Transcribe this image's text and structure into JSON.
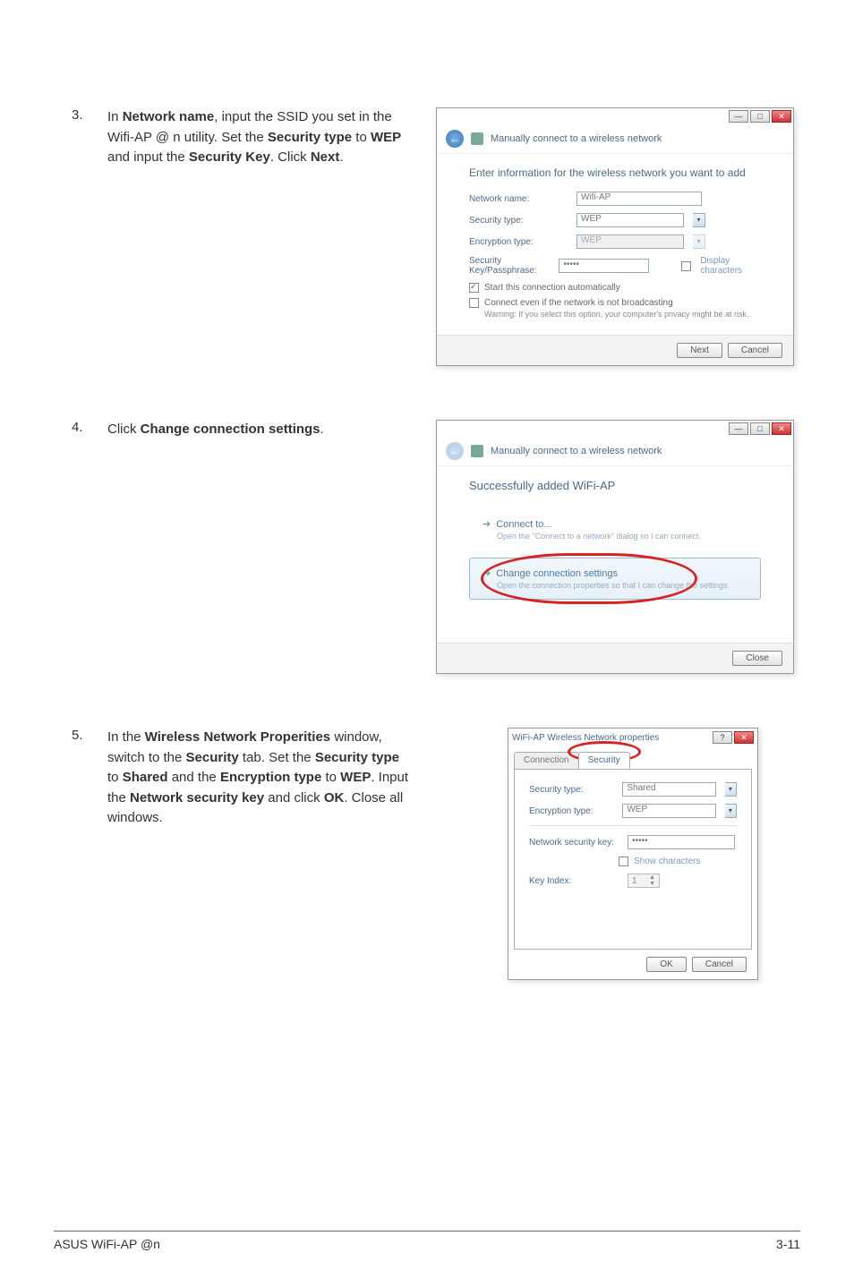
{
  "steps": {
    "s3": {
      "num": "3.",
      "text_parts": [
        "In ",
        "Network name",
        ", input the SSID you set in the Wifi-AP @ n utility. Set the ",
        "Security type",
        " to ",
        "WEP",
        " and input the ",
        "Security Key",
        ". Click ",
        "Next",
        "."
      ]
    },
    "s4": {
      "num": "4.",
      "text_parts": [
        "Click ",
        "Change connection settings",
        "."
      ]
    },
    "s5": {
      "num": "5.",
      "text_parts": [
        "In the ",
        "Wireless Network Properities",
        " window, switch to the ",
        "Security",
        " tab. Set the ",
        "Security type",
        " to ",
        "Shared",
        " and the ",
        "Encryption type",
        " to ",
        "WEP",
        ". Input the ",
        "Network security key",
        " and click ",
        "OK",
        ". Close all windows."
      ]
    }
  },
  "dialog1": {
    "breadcrumb": "Manually connect to a wireless network",
    "heading": "Enter information for the wireless network you want to add",
    "labels": {
      "network_name": "Network name:",
      "security_type": "Security type:",
      "encryption_type": "Encryption type:",
      "security_key": "Security Key/Passphrase:"
    },
    "values": {
      "network_name": "Wifi-AP",
      "security_type": "WEP",
      "encryption_type": "WEP",
      "security_key": "•••••"
    },
    "display_chars": "Display characters",
    "cb1": "Start this connection automatically",
    "cb2": "Connect even if the network is not broadcasting",
    "warning": "Warning: If you select this option, your computer's privacy might be at risk.",
    "btn_next": "Next",
    "btn_cancel": "Cancel"
  },
  "dialog2": {
    "breadcrumb": "Manually connect to a wireless network",
    "heading": "Successfully added WiFi-AP",
    "opt1_title": "Connect to...",
    "opt1_sub": "Open the \"Connect to a network\" dialog so I can connect.",
    "opt2_title": "Change connection settings",
    "opt2_sub": "Open the connection properties so that I can change the settings.",
    "btn_close": "Close"
  },
  "dialog3": {
    "title": "WiFi-AP Wireless Network properties",
    "tab_connection": "Connection",
    "tab_security": "Security",
    "labels": {
      "security_type": "Security type:",
      "encryption_type": "Encryption type:",
      "net_key": "Network security key:",
      "key_index": "Key Index:"
    },
    "values": {
      "security_type": "Shared",
      "encryption_type": "WEP",
      "net_key": "•••••",
      "key_index": "1"
    },
    "show_chars": "Show characters",
    "btn_ok": "OK",
    "btn_cancel": "Cancel"
  },
  "footer": {
    "left": "ASUS WiFi-AP @n",
    "right": "3-11"
  }
}
